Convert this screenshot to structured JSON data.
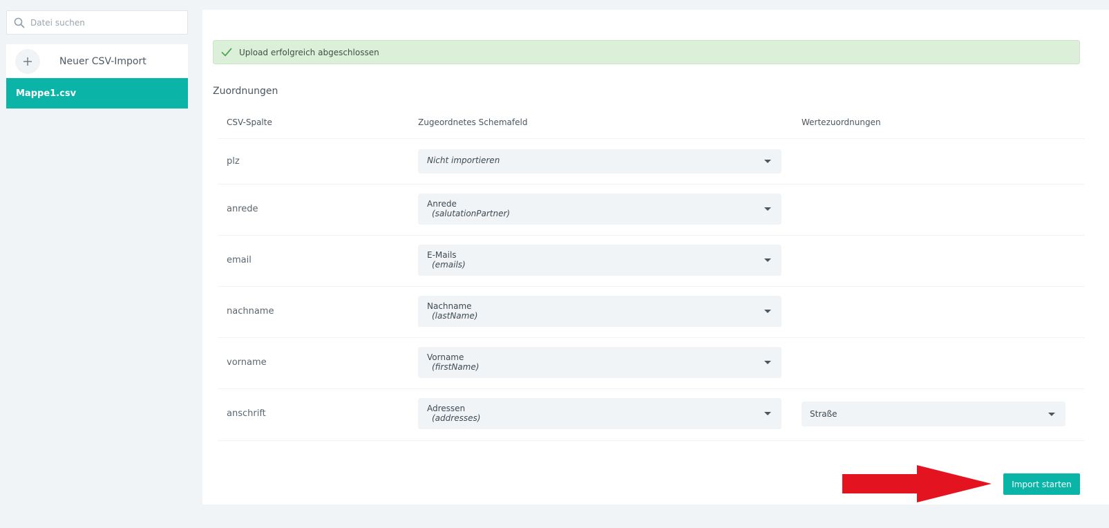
{
  "sidebar": {
    "search_placeholder": "Datei suchen",
    "new_import_label": "Neuer CSV-Import",
    "files": [
      {
        "label": "Mappe1.csv"
      }
    ]
  },
  "main": {
    "success_message": "Upload erfolgreich abgeschlossen",
    "section_title": "Zuordnungen",
    "columns": {
      "csv": "CSV-Spalte",
      "schema": "Zugeordnetes Schemafeld",
      "values": "Wertezuordnungen"
    },
    "rows": [
      {
        "csv": "plz",
        "field": "Nicht importieren",
        "key": ""
      },
      {
        "csv": "anrede",
        "field": "Anrede",
        "key": "(salutationPartner)"
      },
      {
        "csv": "email",
        "field": "E-Mails",
        "key": "(emails)"
      },
      {
        "csv": "nachname",
        "field": "Nachname",
        "key": "(lastName)"
      },
      {
        "csv": "vorname",
        "field": "Vorname",
        "key": "(firstName)"
      },
      {
        "csv": "anschrift",
        "field": "Adressen",
        "key": "(addresses)",
        "value": "Straße"
      }
    ],
    "import_button": "Import starten"
  },
  "colors": {
    "accent": "#0ab5a7",
    "success_bg": "#dcf0d9",
    "arrow": "#e3141f"
  },
  "icons": [
    "search-icon",
    "plus-icon",
    "check-icon",
    "chevron-down-icon",
    "arrow-annotation"
  ]
}
